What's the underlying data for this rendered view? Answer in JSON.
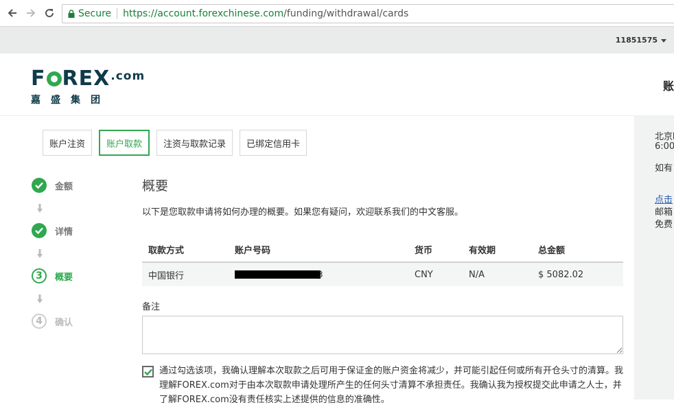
{
  "browser": {
    "secure_label": "Secure",
    "url_host": "https://account.forexchinese.com",
    "url_path": "/funding/withdrawal/cards"
  },
  "account_bar": {
    "account_id": "11851575"
  },
  "header": {
    "logo_pre": "F",
    "logo_post": "REX",
    "logo_suffix": ".com",
    "logo_cn": "嘉盛集团",
    "right_text": "账"
  },
  "tabs": [
    {
      "label": "账户注资",
      "active": false
    },
    {
      "label": "账户取款",
      "active": true
    },
    {
      "label": "注资与取款记录",
      "active": false
    },
    {
      "label": "已绑定信用卡",
      "active": false
    }
  ],
  "steps": [
    {
      "label": "金额",
      "state": "done"
    },
    {
      "label": "详情",
      "state": "done"
    },
    {
      "label": "概要",
      "number": "3",
      "state": "current"
    },
    {
      "label": "确认",
      "number": "4",
      "state": "todo"
    }
  ],
  "main": {
    "title": "概要",
    "description": "以下是您取款申请将如何办理的概要。如果您有疑问，欢迎联系我们的中文客服。",
    "table": {
      "headers": [
        "取款方式",
        "账户号码",
        "货币",
        "有效期",
        "总金额"
      ],
      "row": {
        "method": "中国银行",
        "account_tail": "3",
        "currency": "CNY",
        "expiry": "N/A",
        "total": "$ 5082.02"
      }
    },
    "note_label": "备注",
    "agree_text": "通过勾选该项，我确认理解本次取款之后可用于保证金的账户资金将减少，并可能引起任何或所有开仓头寸的清算。我理解FOREX.com对于由本次取款申请处理所产生的任何头寸清算不承担责任。我确认我为授权提交此申请之人士，并了解FOREX.com没有责任核实上述提供的信息的准确性。"
  },
  "sidebar": {
    "line1": "北京时",
    "line2": "6:00",
    "line3": "如有",
    "link": "点击",
    "line5": "邮箱",
    "line6": "免费"
  },
  "colors": {
    "accent": "#2fa84f",
    "brand": "#0f3b4a"
  }
}
